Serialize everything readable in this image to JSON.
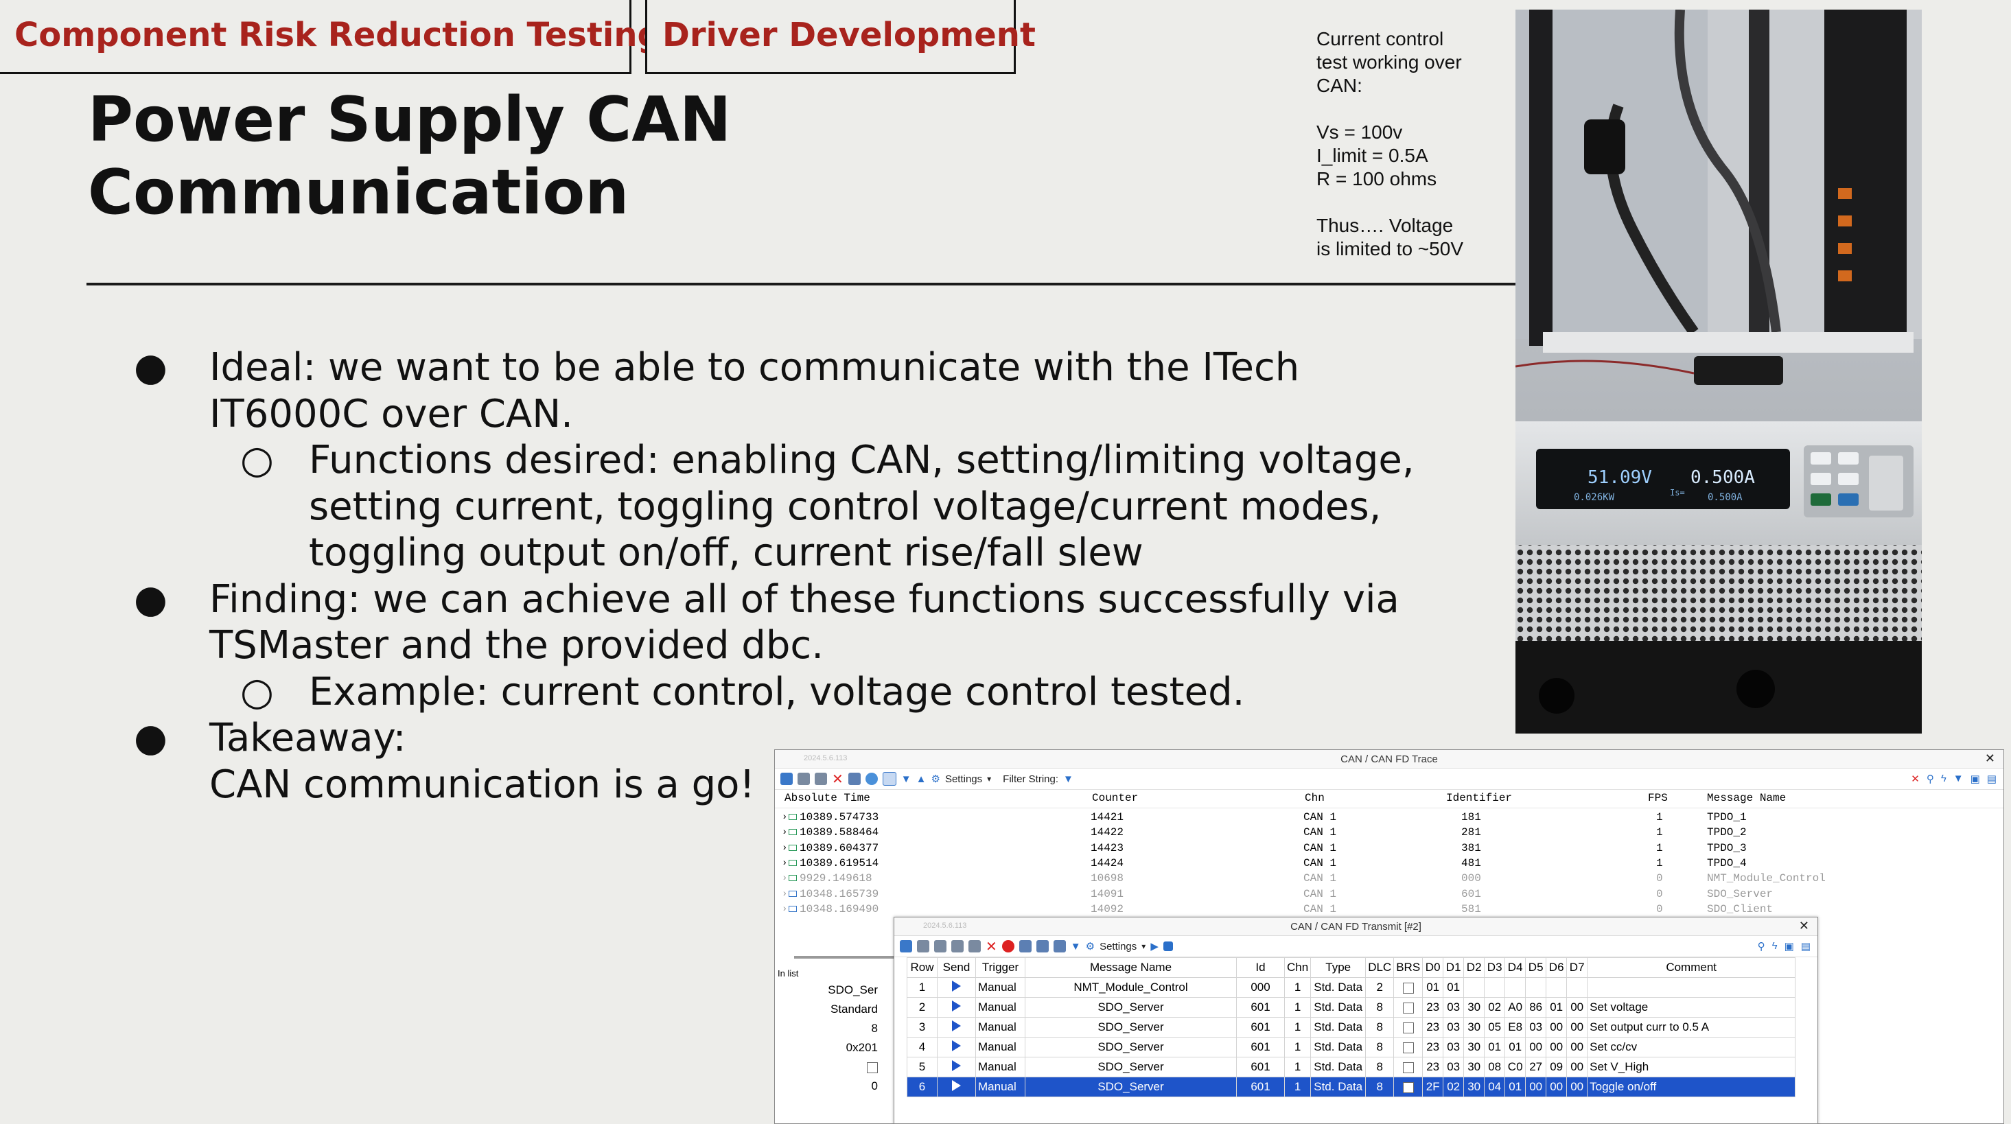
{
  "tags": {
    "left": "Component Risk Reduction Testing",
    "right": "Driver Development"
  },
  "title": {
    "line1": "Power Supply CAN",
    "line2": "Communication"
  },
  "note": "Current control\ntest working over\nCAN:\n\nVs = 100v\nI_limit = 0.5A\nR = 100 ohms\n\nThus…. Voltage\nis limited to ~50V",
  "bullets": {
    "b1": "Ideal: we want to be able to communicate with the ITech IT6000C over CAN.",
    "b1a": "Functions desired: enabling CAN, setting/limiting voltage, setting current, toggling control voltage/current modes, toggling output on/off, current rise/fall slew",
    "b2": "Finding: we can achieve all of these functions successfully via TSMaster and the provided dbc.",
    "b2a": "Example: current control, voltage control tested.",
    "b3a": "Takeaway:",
    "b3b": "CAN communication is a go!",
    "bullet_char": "●",
    "sub_char": "○"
  },
  "photo": {
    "readout_v": "51.09V",
    "readout_a": "0.500A",
    "readout_kw": "0.026KW",
    "readout_is": "0.500A",
    "readout_is_label": "Is="
  },
  "trace": {
    "title": "CAN / CAN FD Trace",
    "stamp": "2024.5.6.113",
    "settings": "Settings",
    "filter": "Filter String:",
    "headers": {
      "time": "Absolute Time",
      "counter": "Counter",
      "chn": "Chn",
      "id": "Identifier",
      "fps": "FPS",
      "msg": "Message Name"
    },
    "rows": [
      {
        "time": "10389.574733",
        "counter": "14421",
        "chn": "CAN 1",
        "id": "181",
        "fps": "1",
        "msg": "TPDO_1"
      },
      {
        "time": "10389.588464",
        "counter": "14422",
        "chn": "CAN 1",
        "id": "281",
        "fps": "1",
        "msg": "TPDO_2"
      },
      {
        "time": "10389.604377",
        "counter": "14423",
        "chn": "CAN 1",
        "id": "381",
        "fps": "1",
        "msg": "TPDO_3"
      },
      {
        "time": "10389.619514",
        "counter": "14424",
        "chn": "CAN 1",
        "id": "481",
        "fps": "1",
        "msg": "TPDO_4"
      },
      {
        "time": "9929.149618",
        "counter": "10698",
        "chn": "CAN 1",
        "id": "000",
        "fps": "0",
        "msg": "NMT_Module_Control"
      },
      {
        "time": "10348.165739",
        "counter": "14091",
        "chn": "CAN 1",
        "id": "601",
        "fps": "0",
        "msg": "SDO_Server"
      },
      {
        "time": "10348.169490",
        "counter": "14092",
        "chn": "CAN 1",
        "id": "581",
        "fps": "0",
        "msg": "SDO_Client"
      }
    ],
    "inlist": "In list",
    "side_values": [
      "SDO_Ser",
      "Standard",
      "8",
      "0x201",
      "",
      "0"
    ]
  },
  "transmit": {
    "title": "CAN / CAN FD Transmit [#2]",
    "stamp": "2024.5.6.113",
    "settings": "Settings",
    "headers": [
      "Row",
      "Send",
      "Trigger",
      "Message Name",
      "Id",
      "Chn",
      "Type",
      "DLC",
      "BRS",
      "D0",
      "D1",
      "D2",
      "D3",
      "D4",
      "D5",
      "D6",
      "D7",
      "Comment"
    ],
    "rows": [
      {
        "row": "1",
        "trigger": "Manual",
        "name": "NMT_Module_Control",
        "id": "000",
        "chn": "1",
        "type": "Std. Data",
        "dlc": "2",
        "d": [
          "01",
          "01",
          "",
          "",
          "",
          "",
          "",
          ""
        ],
        "comment": ""
      },
      {
        "row": "2",
        "trigger": "Manual",
        "name": "SDO_Server",
        "id": "601",
        "chn": "1",
        "type": "Std. Data",
        "dlc": "8",
        "d": [
          "23",
          "03",
          "30",
          "02",
          "A0",
          "86",
          "01",
          "00"
        ],
        "comment": "Set voltage"
      },
      {
        "row": "3",
        "trigger": "Manual",
        "name": "SDO_Server",
        "id": "601",
        "chn": "1",
        "type": "Std. Data",
        "dlc": "8",
        "d": [
          "23",
          "03",
          "30",
          "05",
          "E8",
          "03",
          "00",
          "00"
        ],
        "comment": "Set output curr to 0.5 A"
      },
      {
        "row": "4",
        "trigger": "Manual",
        "name": "SDO_Server",
        "id": "601",
        "chn": "1",
        "type": "Std. Data",
        "dlc": "8",
        "d": [
          "23",
          "03",
          "30",
          "01",
          "01",
          "00",
          "00",
          "00"
        ],
        "comment": "Set cc/cv"
      },
      {
        "row": "5",
        "trigger": "Manual",
        "name": "SDO_Server",
        "id": "601",
        "chn": "1",
        "type": "Std. Data",
        "dlc": "8",
        "d": [
          "23",
          "03",
          "30",
          "08",
          "C0",
          "27",
          "09",
          "00"
        ],
        "comment": "Set V_High"
      },
      {
        "row": "6",
        "trigger": "Manual",
        "name": "SDO_Server",
        "id": "601",
        "chn": "1",
        "type": "Std. Data",
        "dlc": "8",
        "d": [
          "2F",
          "02",
          "30",
          "04",
          "01",
          "00",
          "00",
          "00"
        ],
        "comment": "Toggle on/off"
      }
    ],
    "selected_row": "6"
  }
}
